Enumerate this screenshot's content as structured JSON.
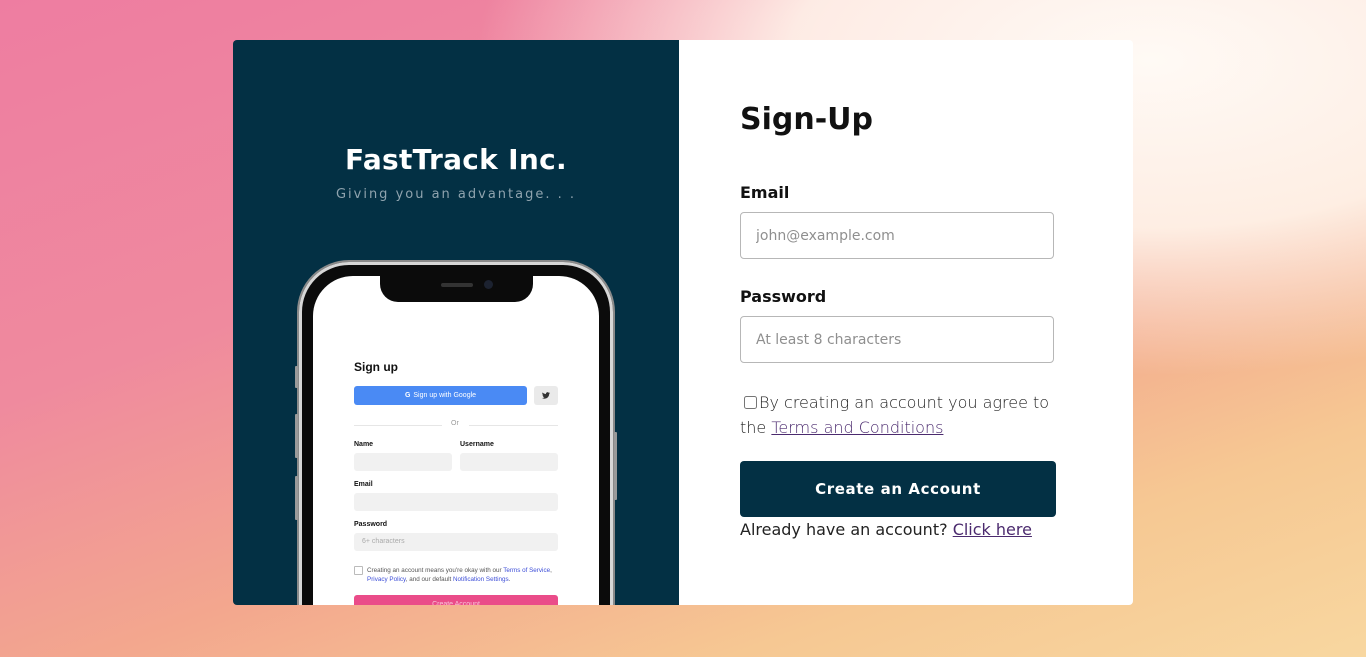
{
  "brand": {
    "title": "FastTrack Inc.",
    "tagline": "Giving you an advantage. . ."
  },
  "mockup": {
    "title": "Sign up",
    "google_button": "Sign up with Google",
    "twitter_icon": "twitter-icon",
    "divider": "Or",
    "name_label": "Name",
    "username_label": "Username",
    "email_label": "Email",
    "password_label": "Password",
    "password_placeholder": "6+ characters",
    "terms_text_1": "Creating an account means you're okay with our",
    "terms_link_1": "Terms of Service",
    "terms_sep": ",",
    "terms_link_2": "Privacy Policy",
    "terms_text_2": ", and our default",
    "terms_link_3": "Notification Settings",
    "terms_end": ".",
    "create_button": "Create Account"
  },
  "form": {
    "title": "Sign-Up",
    "email_label": "Email",
    "email_placeholder": "john@example.com",
    "password_label": "Password",
    "password_placeholder": "At least 8 characters",
    "agree_text": "By creating an account you agree to the",
    "agree_link": "Terms and Conditions",
    "submit_label": "Create an Account",
    "already_text": "Already have an account?",
    "login_link": "Click here"
  },
  "colors": {
    "panel": "#033044",
    "google": "#4a8af4",
    "mockup_accent": "#ea4c89",
    "link": "#4b2a6e"
  }
}
